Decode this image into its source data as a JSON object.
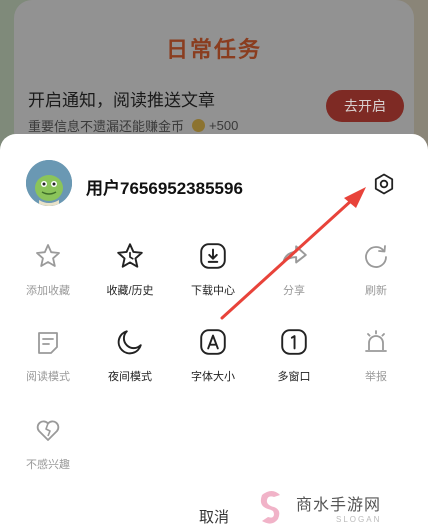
{
  "background": {
    "title": "日常任务",
    "task_title": "开启通知，阅读推送文章",
    "task_subtitle": "重要信息不遗漏还能赚金币",
    "task_reward": "+500",
    "task_button": "去开启"
  },
  "sheet": {
    "username": "用户7656952385596",
    "settings_icon": "gear-icon",
    "rows": [
      [
        {
          "name": "add-favorite",
          "icon": "star-outline-icon",
          "label": "添加收藏",
          "enabled": false
        },
        {
          "name": "favorites-history",
          "icon": "star-clock-icon",
          "label": "收藏/历史",
          "enabled": true
        },
        {
          "name": "download-center",
          "icon": "download-icon",
          "label": "下载中心",
          "enabled": true
        },
        {
          "name": "share",
          "icon": "share-icon",
          "label": "分享",
          "enabled": false
        },
        {
          "name": "refresh",
          "icon": "refresh-icon",
          "label": "刷新",
          "enabled": false
        }
      ],
      [
        {
          "name": "reading-mode",
          "icon": "reader-icon",
          "label": "阅读模式",
          "enabled": false
        },
        {
          "name": "night-mode",
          "icon": "moon-icon",
          "label": "夜间模式",
          "enabled": true
        },
        {
          "name": "font-size",
          "icon": "font-a-icon",
          "label": "字体大小",
          "enabled": true
        },
        {
          "name": "multi-window",
          "icon": "window-one-icon",
          "label": "多窗口",
          "enabled": true
        },
        {
          "name": "report",
          "icon": "alarm-icon",
          "label": "举报",
          "enabled": false
        }
      ],
      [
        {
          "name": "not-interested",
          "icon": "broken-heart-icon",
          "label": "不感兴趣",
          "enabled": false
        }
      ]
    ],
    "cancel_label": "取消"
  },
  "watermark": {
    "main": "商水手游网",
    "sub": "SLOGAN"
  },
  "colors": {
    "annotation_arrow": "#e8433a",
    "muted_text": "#999999",
    "active_text": "#222222"
  }
}
